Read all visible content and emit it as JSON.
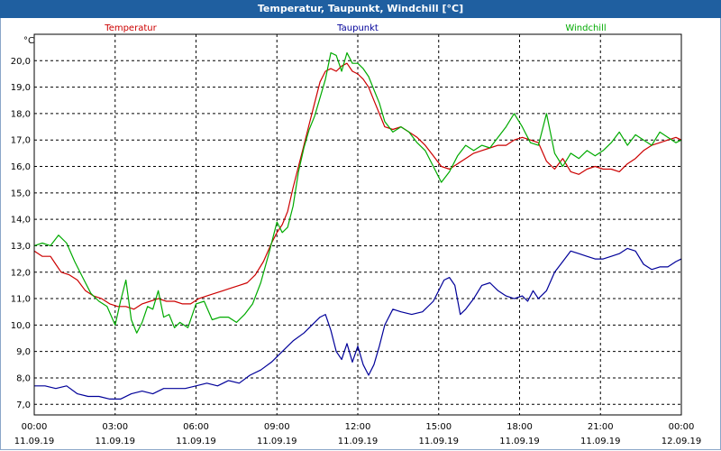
{
  "window": {
    "title": "Temperatur, Taupunkt, Windchill [°C]"
  },
  "chart_data": {
    "type": "line",
    "title": "Temperatur, Taupunkt, Windchill [°C]",
    "ylabel": "°C",
    "ylim": [
      6.6,
      21.0
    ],
    "xlim": [
      0,
      24
    ],
    "y_ticks": [
      "7,0",
      "8,0",
      "9,0",
      "10,0",
      "11,0",
      "12,0",
      "13,0",
      "14,0",
      "15,0",
      "16,0",
      "17,0",
      "18,0",
      "19,0",
      "20,0"
    ],
    "x_ticks": [
      {
        "time": "00:00",
        "date": "11.09.19"
      },
      {
        "time": "03:00",
        "date": "11.09.19"
      },
      {
        "time": "06:00",
        "date": "11.09.19"
      },
      {
        "time": "09:00",
        "date": "11.09.19"
      },
      {
        "time": "12:00",
        "date": "11.09.19"
      },
      {
        "time": "15:00",
        "date": "11.09.19"
      },
      {
        "time": "18:00",
        "date": "11.09.19"
      },
      {
        "time": "21:00",
        "date": "11.09.19"
      },
      {
        "time": "00:00",
        "date": "12.09.19"
      }
    ],
    "grid": true,
    "series": [
      {
        "name": "Temperatur",
        "color": "#cc0000",
        "x": [
          0,
          0.3,
          0.6,
          0.8,
          1.0,
          1.3,
          1.6,
          1.9,
          2.2,
          2.5,
          2.8,
          3.1,
          3.4,
          3.7,
          4.0,
          4.3,
          4.6,
          4.9,
          5.2,
          5.5,
          5.8,
          6.1,
          6.4,
          6.7,
          7.0,
          7.3,
          7.6,
          7.9,
          8.2,
          8.5,
          8.8,
          9.0,
          9.2,
          9.4,
          9.6,
          9.8,
          10.0,
          10.2,
          10.4,
          10.6,
          10.8,
          11.0,
          11.2,
          11.4,
          11.6,
          11.8,
          12.0,
          12.2,
          12.4,
          12.6,
          12.8,
          13.0,
          13.3,
          13.6,
          13.9,
          14.2,
          14.5,
          14.8,
          15.1,
          15.4,
          15.7,
          16.0,
          16.3,
          16.6,
          16.9,
          17.2,
          17.5,
          17.8,
          18.1,
          18.4,
          18.7,
          19.0,
          19.3,
          19.6,
          19.9,
          20.2,
          20.5,
          20.8,
          21.1,
          21.4,
          21.7,
          22.0,
          22.3,
          22.6,
          22.9,
          23.2,
          23.5,
          23.8,
          24.0
        ],
        "y": [
          12.8,
          12.6,
          12.6,
          12.3,
          12.0,
          11.9,
          11.7,
          11.3,
          11.1,
          11.0,
          10.8,
          10.7,
          10.7,
          10.6,
          10.8,
          10.9,
          11.0,
          10.9,
          10.9,
          10.8,
          10.8,
          11.0,
          11.1,
          11.2,
          11.3,
          11.4,
          11.5,
          11.6,
          11.9,
          12.4,
          13.1,
          13.5,
          13.8,
          14.3,
          15.2,
          16.0,
          16.8,
          17.6,
          18.4,
          19.2,
          19.6,
          19.7,
          19.6,
          19.8,
          19.9,
          19.6,
          19.5,
          19.3,
          19.0,
          18.5,
          18.0,
          17.5,
          17.4,
          17.5,
          17.3,
          17.1,
          16.8,
          16.4,
          16.0,
          15.9,
          16.1,
          16.3,
          16.5,
          16.6,
          16.7,
          16.8,
          16.8,
          17.0,
          17.1,
          17.0,
          16.9,
          16.2,
          15.9,
          16.3,
          15.8,
          15.7,
          15.9,
          16.0,
          15.9,
          15.9,
          15.8,
          16.1,
          16.3,
          16.6,
          16.8,
          16.9,
          17.0,
          17.1,
          17.0
        ]
      },
      {
        "name": "Taupunkt",
        "color": "#000099",
        "x": [
          0,
          0.4,
          0.8,
          1.2,
          1.6,
          2.0,
          2.4,
          2.8,
          3.2,
          3.6,
          4.0,
          4.4,
          4.8,
          5.2,
          5.6,
          6.0,
          6.4,
          6.8,
          7.2,
          7.6,
          8.0,
          8.4,
          8.8,
          9.2,
          9.6,
          10.0,
          10.3,
          10.6,
          10.8,
          11.0,
          11.2,
          11.4,
          11.6,
          11.8,
          12.0,
          12.2,
          12.4,
          12.6,
          12.8,
          13.0,
          13.3,
          13.6,
          14.0,
          14.4,
          14.8,
          15.2,
          15.4,
          15.6,
          15.8,
          16.0,
          16.3,
          16.6,
          16.9,
          17.2,
          17.5,
          17.8,
          18.1,
          18.3,
          18.5,
          18.7,
          19.0,
          19.3,
          19.6,
          19.9,
          20.2,
          20.5,
          20.8,
          21.1,
          21.4,
          21.7,
          22.0,
          22.3,
          22.6,
          22.9,
          23.2,
          23.5,
          23.8,
          24.0
        ],
        "y": [
          7.7,
          7.7,
          7.6,
          7.7,
          7.4,
          7.3,
          7.3,
          7.2,
          7.2,
          7.4,
          7.5,
          7.4,
          7.6,
          7.6,
          7.6,
          7.7,
          7.8,
          7.7,
          7.9,
          7.8,
          8.1,
          8.3,
          8.6,
          9.0,
          9.4,
          9.7,
          10.0,
          10.3,
          10.4,
          9.8,
          9.0,
          8.7,
          9.3,
          8.6,
          9.2,
          8.5,
          8.1,
          8.5,
          9.2,
          10.0,
          10.6,
          10.5,
          10.4,
          10.5,
          10.9,
          11.7,
          11.8,
          11.5,
          10.4,
          10.6,
          11.0,
          11.5,
          11.6,
          11.3,
          11.1,
          11.0,
          11.1,
          10.9,
          11.3,
          11.0,
          11.3,
          12.0,
          12.4,
          12.8,
          12.7,
          12.6,
          12.5,
          12.5,
          12.6,
          12.7,
          12.9,
          12.8,
          12.3,
          12.1,
          12.2,
          12.2,
          12.4,
          12.5
        ]
      },
      {
        "name": "Windchill",
        "color": "#00aa00",
        "x": [
          0,
          0.3,
          0.6,
          0.9,
          1.2,
          1.5,
          1.8,
          2.1,
          2.4,
          2.7,
          3.0,
          3.2,
          3.4,
          3.6,
          3.8,
          4.0,
          4.2,
          4.4,
          4.6,
          4.8,
          5.0,
          5.2,
          5.4,
          5.7,
          6.0,
          6.3,
          6.6,
          6.9,
          7.2,
          7.5,
          7.8,
          8.1,
          8.4,
          8.7,
          9.0,
          9.2,
          9.4,
          9.6,
          9.8,
          10.0,
          10.2,
          10.4,
          10.6,
          10.8,
          11.0,
          11.2,
          11.4,
          11.6,
          11.8,
          12.0,
          12.2,
          12.4,
          12.6,
          12.8,
          13.0,
          13.3,
          13.6,
          13.9,
          14.2,
          14.5,
          14.8,
          15.1,
          15.4,
          15.7,
          16.0,
          16.3,
          16.6,
          16.9,
          17.2,
          17.5,
          17.8,
          18.1,
          18.4,
          18.7,
          19.0,
          19.3,
          19.6,
          19.9,
          20.2,
          20.5,
          20.8,
          21.1,
          21.4,
          21.7,
          22.0,
          22.3,
          22.6,
          22.9,
          23.2,
          23.5,
          23.8,
          24.0
        ],
        "y": [
          13.0,
          13.1,
          13.0,
          13.4,
          13.1,
          12.4,
          11.8,
          11.2,
          10.9,
          10.7,
          10.0,
          10.9,
          11.7,
          10.2,
          9.7,
          10.1,
          10.7,
          10.6,
          11.3,
          10.3,
          10.4,
          9.9,
          10.1,
          9.9,
          10.8,
          10.9,
          10.2,
          10.3,
          10.3,
          10.1,
          10.4,
          10.8,
          11.6,
          12.7,
          13.9,
          13.5,
          13.7,
          14.5,
          15.8,
          16.7,
          17.4,
          17.9,
          18.6,
          19.3,
          20.3,
          20.2,
          19.6,
          20.3,
          19.9,
          19.9,
          19.7,
          19.4,
          18.9,
          18.4,
          17.7,
          17.3,
          17.5,
          17.3,
          16.9,
          16.6,
          16.0,
          15.4,
          15.8,
          16.4,
          16.8,
          16.6,
          16.8,
          16.7,
          17.1,
          17.5,
          18.0,
          17.5,
          16.9,
          16.8,
          18.0,
          16.5,
          16.0,
          16.5,
          16.3,
          16.6,
          16.4,
          16.6,
          16.9,
          17.3,
          16.8,
          17.2,
          17.0,
          16.8,
          17.3,
          17.1,
          16.9,
          17.0
        ]
      }
    ]
  }
}
